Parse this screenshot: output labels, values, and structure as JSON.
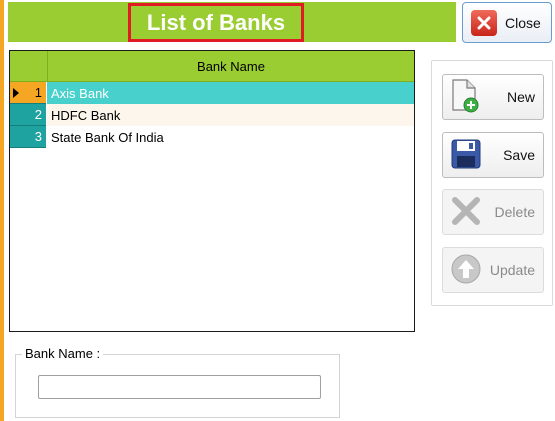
{
  "header": {
    "title": "List of Banks",
    "close_label": "Close"
  },
  "grid": {
    "column_header": "Bank Name",
    "rows": [
      {
        "index": "1",
        "name": "Axis Bank",
        "selected": true
      },
      {
        "index": "2",
        "name": "HDFC Bank",
        "selected": false
      },
      {
        "index": "3",
        "name": "State Bank Of India",
        "selected": false
      }
    ]
  },
  "actions": {
    "new_label": "New",
    "save_label": "Save",
    "delete_label": "Delete",
    "update_label": "Update"
  },
  "form": {
    "group_label": "Bank Name :",
    "bank_name_value": ""
  },
  "colors": {
    "header_green": "#9acd32",
    "title_border_red": "#e01b24",
    "selected_row_cyan": "#48d1cc",
    "row_header_teal": "#1fa3a0",
    "accent_orange": "#f5a623"
  },
  "icons": {
    "close": "close-x-icon",
    "new": "new-document-icon",
    "save": "floppy-disk-icon",
    "delete": "delete-x-icon",
    "update": "update-arrow-icon",
    "current_row": "current-row-arrow-icon"
  }
}
